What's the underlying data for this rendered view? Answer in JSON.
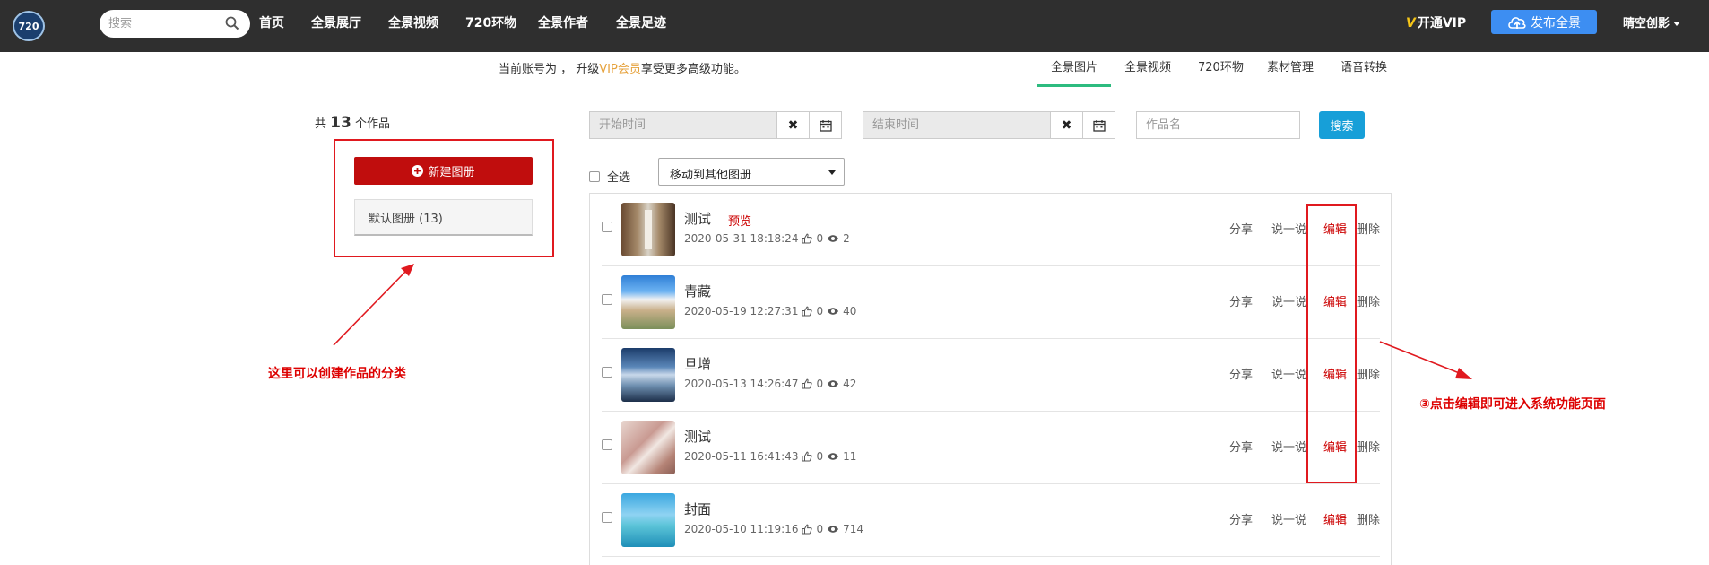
{
  "header": {
    "logo_text": "720",
    "search_placeholder": "搜索",
    "nav": [
      "首页",
      "全景展厅",
      "全景视频",
      "720环物",
      "全景作者",
      "全景足迹"
    ],
    "vip_mark": "V",
    "vip_label": "开通VIP",
    "publish_label": "发布全景",
    "user_name": "晴空创影"
  },
  "notice": {
    "prefix": "当前账号为 ，  升级",
    "vip": "VIP会员",
    "suffix": "享受更多高级功能。"
  },
  "tabs": [
    "全景图片",
    "全景视频",
    "720环物",
    "素材管理",
    "语音转换"
  ],
  "sidebar": {
    "count_prefix": "共",
    "count": "13",
    "count_suffix": "个作品",
    "new_album_label": "新建图册",
    "default_album_label": "默认图册 (13)"
  },
  "filters": {
    "start_placeholder": "开始时间",
    "end_placeholder": "结束时间",
    "name_placeholder": "作品名",
    "search_label": "搜索",
    "clear_glyph": "✖"
  },
  "bulk": {
    "select_all_label": "全选",
    "move_label": "移动到其他图册"
  },
  "works": [
    {
      "title": "测试",
      "preview": "预览",
      "date": "2020-05-31 18:18:24",
      "likes": "0",
      "views": "2"
    },
    {
      "title": "青藏",
      "preview": "",
      "date": "2020-05-19 12:27:31",
      "likes": "0",
      "views": "40"
    },
    {
      "title": "旦增",
      "preview": "",
      "date": "2020-05-13 14:26:47",
      "likes": "0",
      "views": "42"
    },
    {
      "title": "测试",
      "preview": "",
      "date": "2020-05-11 16:41:43",
      "likes": "0",
      "views": "11"
    },
    {
      "title": "封面",
      "preview": "",
      "date": "2020-05-10 11:19:16",
      "likes": "0",
      "views": "714"
    }
  ],
  "row_actions": {
    "share": "分享",
    "talk": "说一说",
    "edit": "编辑",
    "delete": "删除"
  },
  "annotations": {
    "left": "这里可以创建作品的分类",
    "right": "③点击编辑即可进入系统功能页面"
  },
  "colors": {
    "accent_red": "#c00d0d",
    "publish_blue": "#3d8ef2",
    "search_blue": "#179fd8",
    "tab_green": "#2dbb7f",
    "vip_gold": "#e6a23c"
  }
}
